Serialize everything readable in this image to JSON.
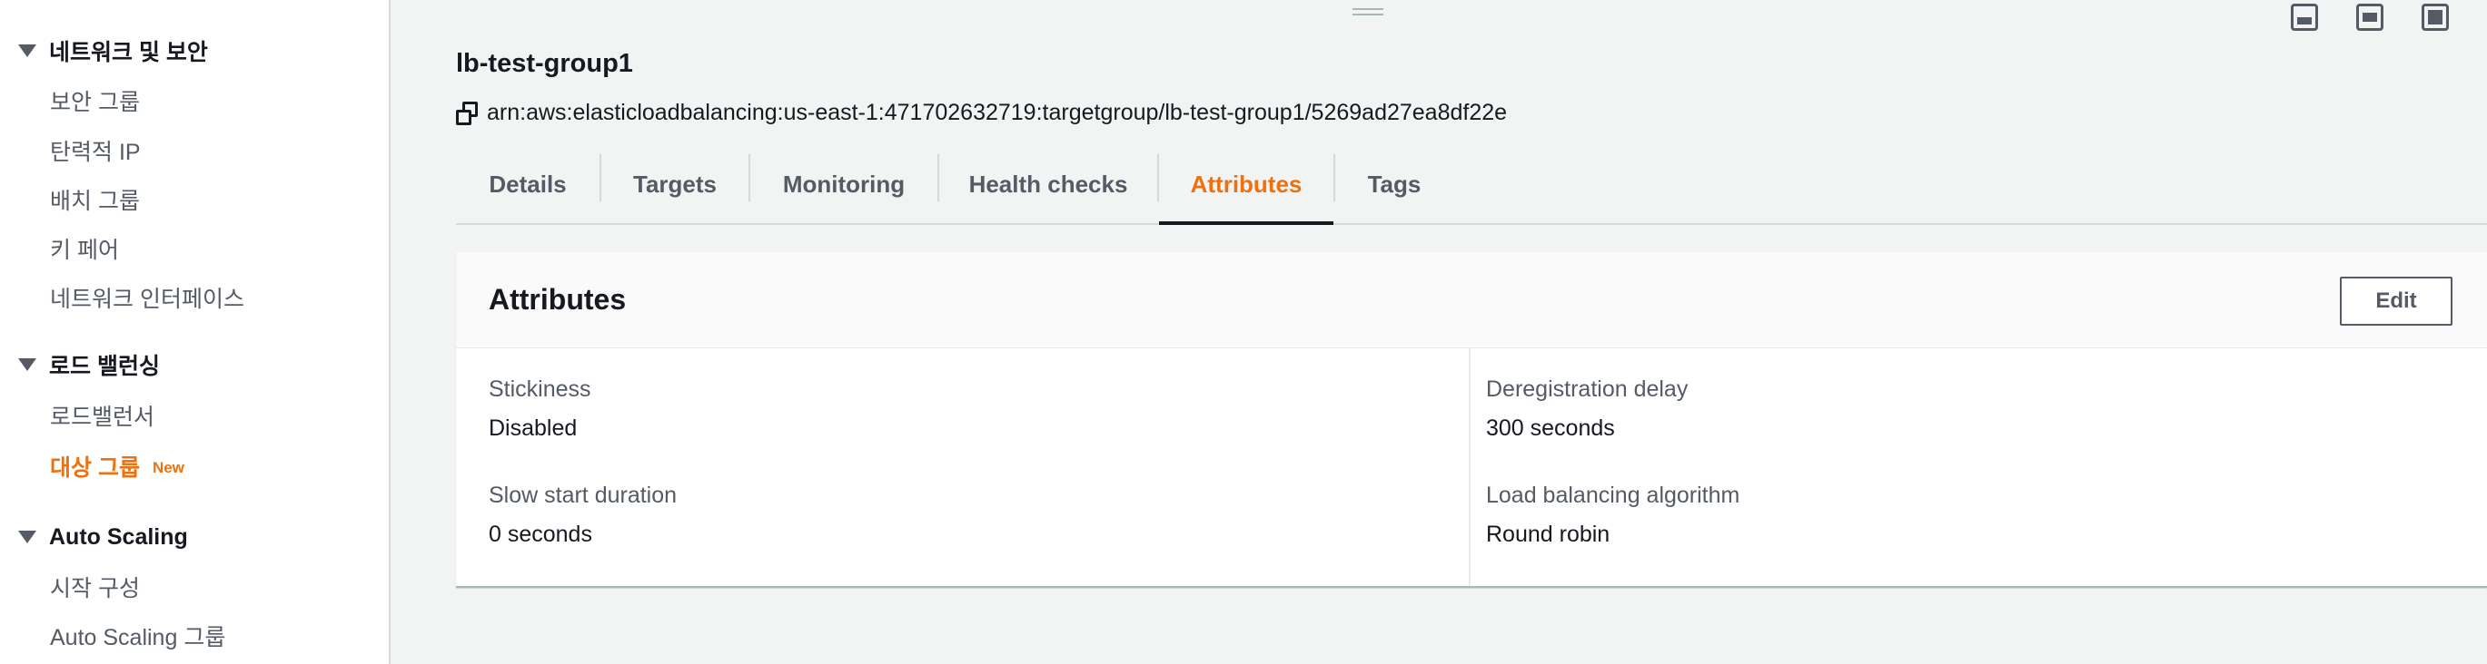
{
  "sidebar": {
    "sections": [
      {
        "title": "네트워크 및 보안",
        "items": [
          {
            "label": "보안 그룹"
          },
          {
            "label": "탄력적 IP"
          },
          {
            "label": "배치 그룹"
          },
          {
            "label": "키 페어"
          },
          {
            "label": "네트워크 인터페이스"
          }
        ]
      },
      {
        "title": "로드 밸런싱",
        "items": [
          {
            "label": "로드밸런서"
          },
          {
            "label": "대상 그룹",
            "badge": "New"
          }
        ]
      },
      {
        "title": "Auto Scaling",
        "items": [
          {
            "label": "시작 구성"
          },
          {
            "label": "Auto Scaling 그룹"
          }
        ]
      }
    ],
    "active_item": "대상 그룹"
  },
  "header": {
    "title": "lb-test-group1",
    "arn": "arn:aws:elasticloadbalancing:us-east-1:471702632719:targetgroup/lb-test-group1/5269ad27ea8df22e"
  },
  "tabs": [
    {
      "label": "Details"
    },
    {
      "label": "Targets"
    },
    {
      "label": "Monitoring"
    },
    {
      "label": "Health checks"
    },
    {
      "label": "Attributes"
    },
    {
      "label": "Tags"
    }
  ],
  "active_tab": "Attributes",
  "attributes_panel": {
    "title": "Attributes",
    "edit_label": "Edit",
    "fields": [
      {
        "label": "Stickiness",
        "value": "Disabled"
      },
      {
        "label": "Deregistration delay",
        "value": "300 seconds"
      },
      {
        "label": "Slow start duration",
        "value": "0 seconds"
      },
      {
        "label": "Load balancing algorithm",
        "value": "Round robin"
      }
    ]
  },
  "colors": {
    "accent": "#ec7211",
    "text": "#16191f",
    "muted": "#545b64",
    "border": "#d5dbdb",
    "background": "#f2f3f3"
  },
  "icons": {
    "section_toggle": "caret-down-icon",
    "copy": "copy-icon",
    "layout": [
      "panel-bottom-icon",
      "panel-middle-icon",
      "panel-full-icon"
    ]
  }
}
